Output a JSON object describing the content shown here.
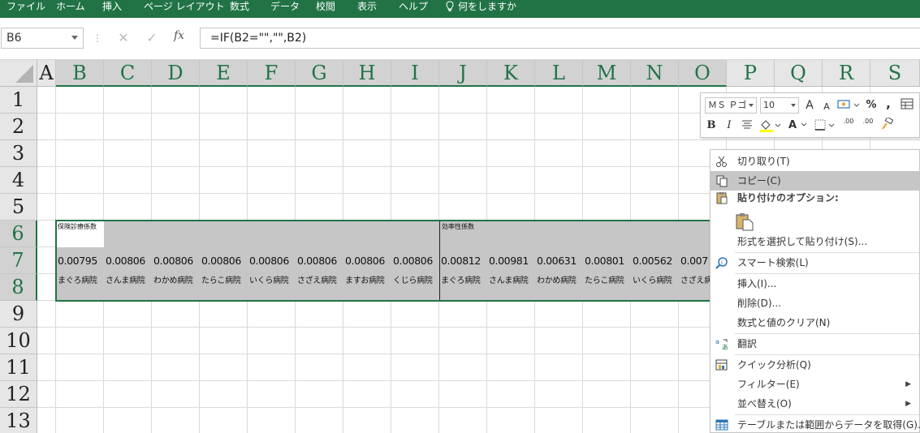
{
  "menu": {
    "items": [
      "ファイル",
      "ホーム",
      "挿入",
      "ページ レイアウト",
      "数式",
      "データ",
      "校閲",
      "表示",
      "ヘルプ"
    ],
    "tell_me": "何をしますか"
  },
  "formula_bar": {
    "name_box": "B6",
    "fx": "fx",
    "formula": "=IF(B2=\"\",\"\",B2)"
  },
  "sheet": {
    "columns": [
      "A",
      "B",
      "C",
      "D",
      "E",
      "F",
      "G",
      "H",
      "I",
      "J",
      "K",
      "L",
      "M",
      "N",
      "O",
      "P",
      "Q",
      "R",
      "S"
    ],
    "rows": [
      "1",
      "2",
      "3",
      "4",
      "5",
      "6",
      "7",
      "8",
      "9",
      "10",
      "11",
      "12",
      "13"
    ],
    "row6": {
      "B": "保険診療係数",
      "J": "効率性係数"
    },
    "row7": [
      "0.00795",
      "0.00806",
      "0.00806",
      "0.00806",
      "0.00806",
      "0.00806",
      "0.00806",
      "0.00806",
      "0.00812",
      "0.00981",
      "0.00631",
      "0.00801",
      "0.00562",
      "0.007"
    ],
    "row8": [
      "まぐろ病院",
      "さんま病院",
      "わかめ病院",
      "たらこ病院",
      "いくら病院",
      "さざえ病院",
      "ますお病院",
      "くじら病院",
      "まぐろ病院",
      "さんま病院",
      "わかめ病院",
      "たらこ病院",
      "いくら病院",
      "さざえ病"
    ]
  },
  "mini_toolbar": {
    "font_name": "ＭＳ Ｐゴ",
    "font_size": "10",
    "grow": "A",
    "shrink": "A",
    "percent": "%",
    "comma": ",",
    "bold": "B",
    "italic": "I",
    "font_color": "A",
    "decimal_inc": ".00",
    "decimal_dec": ".00"
  },
  "context_menu": {
    "cut": "切り取り(T)",
    "copy": "コピー(C)",
    "paste_options": "貼り付けのオプション:",
    "paste_special": "形式を選択して貼り付け(S)...",
    "smart_lookup": "スマート検索(L)",
    "insert": "挿入(I)...",
    "delete": "削除(D)...",
    "clear": "数式と値のクリア(N)",
    "translate": "翻訳",
    "quick_analysis": "クイック分析(Q)",
    "filter": "フィルター(E)",
    "sort": "並べ替え(O)",
    "table_range": "テーブルまたは範囲からデータを取得(G)..."
  },
  "colors": {
    "ribbon_green": "#217346",
    "selection_gray": "#c6c6c6",
    "header_gray": "#e6e6e6"
  }
}
